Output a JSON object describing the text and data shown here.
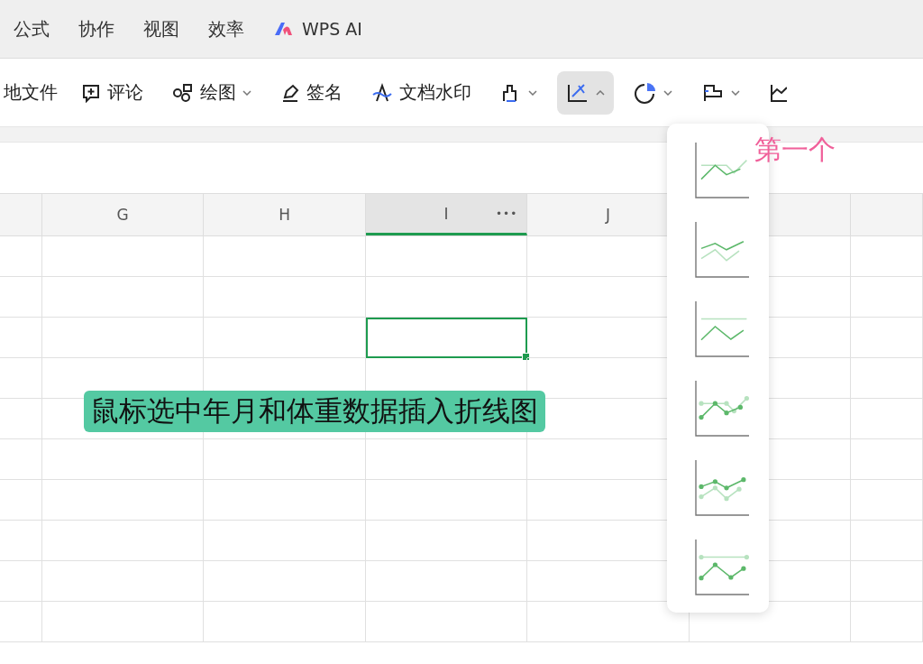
{
  "menu": [
    {
      "kind": "text",
      "label": "公式"
    },
    {
      "kind": "text",
      "label": "协作"
    },
    {
      "kind": "text",
      "label": "视图"
    },
    {
      "kind": "text",
      "label": "效率"
    },
    {
      "kind": "ai",
      "label": "WPS AI"
    }
  ],
  "toolbar": [
    {
      "kind": "text",
      "label": "地文件",
      "selected": false
    },
    {
      "kind": "comment",
      "label": "评论",
      "selected": false
    },
    {
      "kind": "draw",
      "label": "绘图",
      "expanded": false,
      "selected": false
    },
    {
      "kind": "sign",
      "label": "签名",
      "selected": false
    },
    {
      "kind": "watermark",
      "label": "文档水印",
      "selected": false
    },
    {
      "kind": "bar",
      "expanded": false,
      "selected": false
    },
    {
      "kind": "line",
      "expanded": true,
      "selected": true
    },
    {
      "kind": "pie",
      "expanded": false,
      "selected": false
    },
    {
      "kind": "hbar",
      "expanded": false,
      "selected": false
    },
    {
      "kind": "area",
      "selected": false
    }
  ],
  "columns": [
    {
      "selected": false
    },
    {
      "label": "G",
      "selected": false
    },
    {
      "label": "H",
      "selected": false
    },
    {
      "label": "I",
      "selected": true,
      "more": "•••"
    },
    {
      "label": "J",
      "selected": false
    },
    {
      "selected": false
    },
    {
      "selected": false
    }
  ],
  "rows": [
    {
      "cells": [
        {
          "selected": false
        },
        {
          "selected": false
        },
        {
          "selected": false
        },
        {
          "selected": false
        },
        {
          "selected": false
        },
        {
          "selected": false
        },
        {
          "selected": false
        }
      ]
    },
    {
      "cells": [
        {
          "selected": false
        },
        {
          "selected": false
        },
        {
          "selected": false
        },
        {
          "selected": false
        },
        {
          "selected": false
        },
        {
          "selected": false
        },
        {
          "selected": false
        }
      ]
    },
    {
      "cells": [
        {
          "selected": false
        },
        {
          "selected": false
        },
        {
          "selected": false
        },
        {
          "selected": true
        },
        {
          "selected": false
        },
        {
          "selected": false
        },
        {
          "selected": false
        }
      ]
    },
    {
      "cells": [
        {
          "selected": false
        },
        {
          "selected": false
        },
        {
          "selected": false
        },
        {
          "selected": false
        },
        {
          "selected": false
        },
        {
          "selected": false
        },
        {
          "selected": false
        }
      ]
    },
    {
      "cells": [
        {
          "selected": false
        },
        {
          "selected": false
        },
        {
          "selected": false
        },
        {
          "selected": false
        },
        {
          "selected": false
        },
        {
          "selected": false
        },
        {
          "selected": false
        }
      ]
    },
    {
      "cells": [
        {
          "selected": false
        },
        {
          "selected": false
        },
        {
          "selected": false
        },
        {
          "selected": false
        },
        {
          "selected": false
        },
        {
          "selected": false
        },
        {
          "selected": false
        }
      ]
    },
    {
      "cells": [
        {
          "selected": false
        },
        {
          "selected": false
        },
        {
          "selected": false
        },
        {
          "selected": false
        },
        {
          "selected": false
        },
        {
          "selected": false
        },
        {
          "selected": false
        }
      ]
    },
    {
      "cells": [
        {
          "selected": false
        },
        {
          "selected": false
        },
        {
          "selected": false
        },
        {
          "selected": false
        },
        {
          "selected": false
        },
        {
          "selected": false
        },
        {
          "selected": false
        }
      ]
    },
    {
      "cells": [
        {
          "selected": false
        },
        {
          "selected": false
        },
        {
          "selected": false
        },
        {
          "selected": false
        },
        {
          "selected": false
        },
        {
          "selected": false
        },
        {
          "selected": false
        }
      ]
    },
    {
      "cells": [
        {
          "selected": false
        },
        {
          "selected": false
        },
        {
          "selected": false
        },
        {
          "selected": false
        },
        {
          "selected": false
        },
        {
          "selected": false
        },
        {
          "selected": false
        }
      ]
    }
  ],
  "chart_menu": [
    {
      "kind": "line"
    },
    {
      "kind": "stacked_line"
    },
    {
      "kind": "percent_line"
    },
    {
      "kind": "line_markers"
    },
    {
      "kind": "stacked_markers"
    },
    {
      "kind": "percent_markers"
    }
  ],
  "annotations": [
    {
      "kind": "note",
      "text": "第一个"
    },
    {
      "kind": "banner",
      "text": "鼠标选中年月和体重数据插入折线图"
    }
  ]
}
